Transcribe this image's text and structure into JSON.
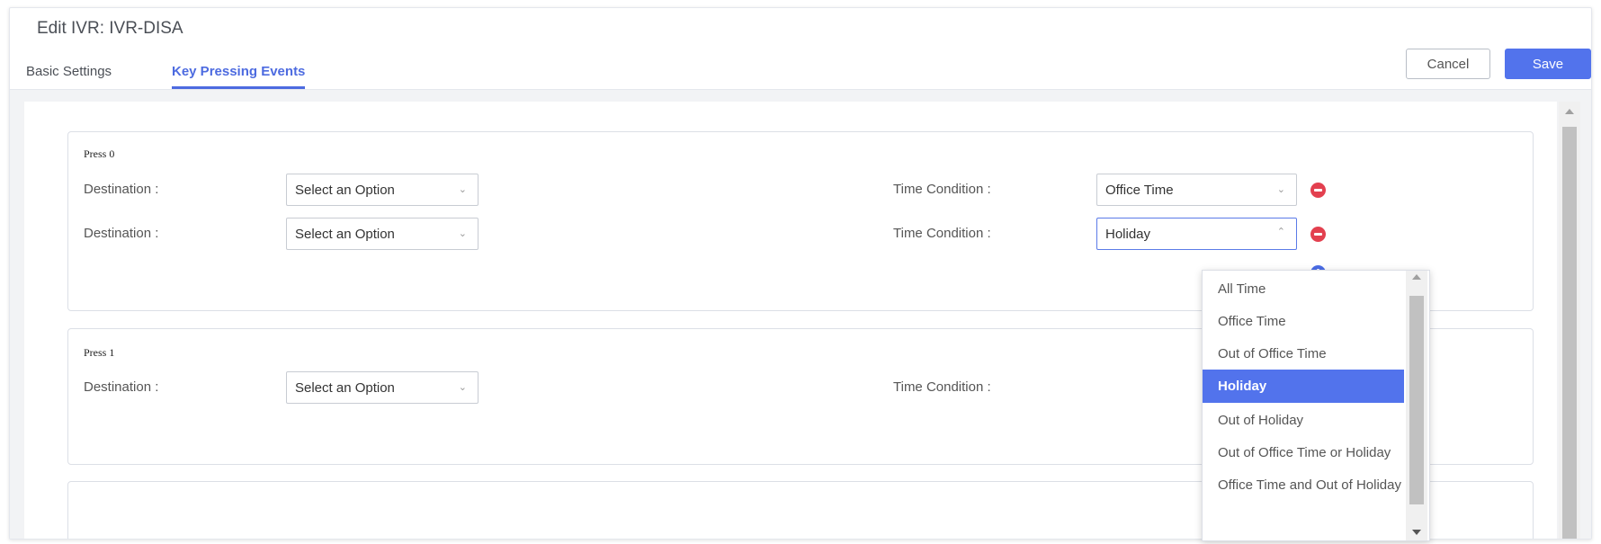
{
  "header": {
    "title": "Edit IVR: IVR-DISA",
    "tabs": [
      {
        "label": "Basic Settings",
        "active": false
      },
      {
        "label": "Key Pressing Events",
        "active": true
      }
    ],
    "cancel_label": "Cancel",
    "save_label": "Save"
  },
  "colors": {
    "accent": "#5273ec",
    "remove": "#e3404f",
    "add": "#4b6de6"
  },
  "events": [
    {
      "title": "Press 0",
      "rows": [
        {
          "destination_label": "Destination :",
          "destination_value": "Select an Option",
          "time_label": "Time Condition :",
          "time_value": "Office Time"
        },
        {
          "destination_label": "Destination :",
          "destination_value": "Select an Option",
          "time_label": "Time Condition :",
          "time_value": "Holiday"
        }
      ]
    },
    {
      "title": "Press 1",
      "rows": [
        {
          "destination_label": "Destination :",
          "destination_value": "Select an Option",
          "time_label": "Time Condition :",
          "time_value": ""
        }
      ]
    }
  ],
  "time_condition_options": [
    "All Time",
    "Office Time",
    "Out of Office Time",
    "Holiday",
    "Out of Holiday",
    "Out of Office Time or Holiday",
    "Office Time and Out of Holiday"
  ],
  "selected_option": "Holiday",
  "icons": [
    "chevron-down-icon",
    "chevron-up-icon",
    "remove-circle-icon",
    "add-circle-icon"
  ]
}
